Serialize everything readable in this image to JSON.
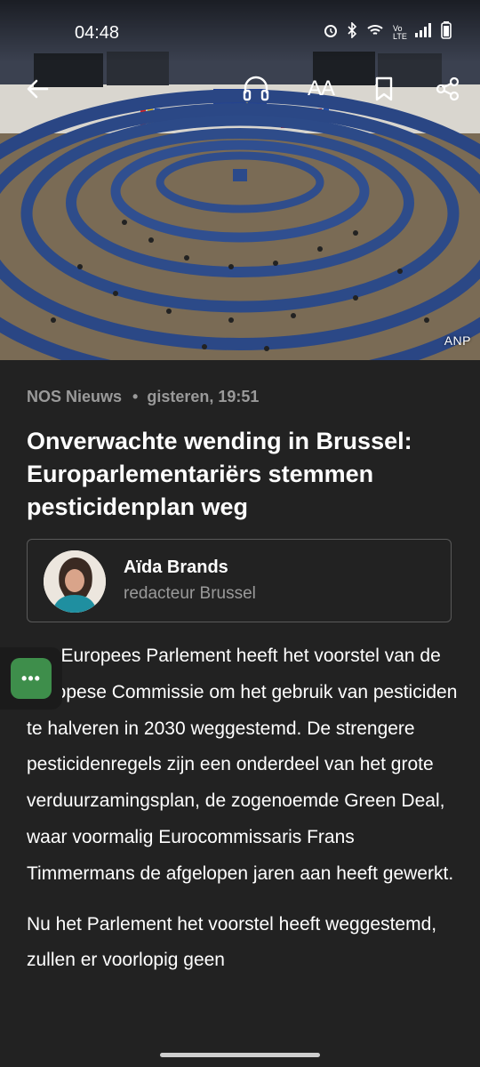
{
  "status_bar": {
    "time": "04:48",
    "icons": [
      "alarm-icon",
      "bluetooth-icon",
      "wifi-icon",
      "volte-icon",
      "signal-icon",
      "battery-icon"
    ],
    "volte_label": "Vo LTE"
  },
  "hero": {
    "credit": "ANP"
  },
  "toolbar": {
    "icons": [
      "back-arrow-icon",
      "headphones-icon",
      "text-size-icon",
      "bookmark-icon",
      "share-icon"
    ],
    "text_size_label": "AA"
  },
  "article": {
    "source": "NOS Nieuws",
    "separator": "•",
    "timestamp": "gisteren, 19:51",
    "title": "Onverwachte wending in Brussel: Europarlementariërs stemmen pesticidenplan weg",
    "author": {
      "name": "Aïda Brands",
      "role": "redacteur Brussel"
    },
    "paragraphs": [
      "Het Europees Parlement heeft het voorstel van de Europese Commissie om het gebruik van pesticiden te halveren in 2030 weggestemd. De strengere pesticidenregels zijn een onderdeel van het grote verduurzamingsplan, de zogenoemde Green Deal, waar voormalig Eurocommissaris Frans Timmermans de afgelopen jaren aan heeft gewerkt.",
      "Nu het Parlement het voorstel heeft weggestemd, zullen er voorlopig geen"
    ]
  },
  "floating_bubble": {
    "label": "•••"
  },
  "colors": {
    "background": "#222222",
    "meta_gray": "#9a9a9a",
    "card_border": "#5a5a5a",
    "bubble_green": "#3e8e4b"
  }
}
